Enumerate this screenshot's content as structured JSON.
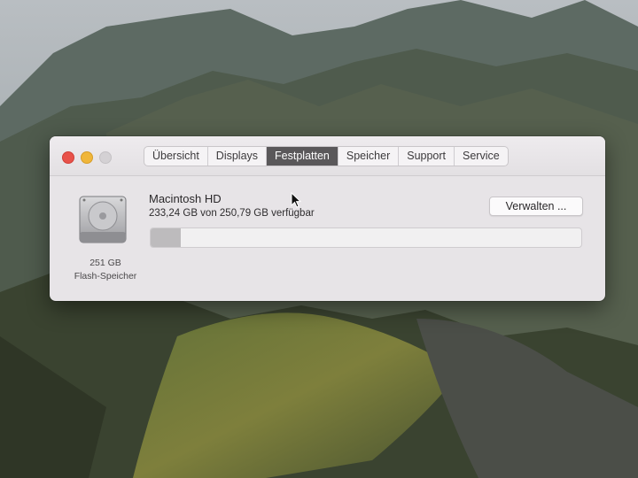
{
  "window": {
    "title_tabs": [
      {
        "label": "Übersicht",
        "active": false
      },
      {
        "label": "Displays",
        "active": false
      },
      {
        "label": "Festplatten",
        "active": true
      },
      {
        "label": "Speicher",
        "active": false
      },
      {
        "label": "Support",
        "active": false
      },
      {
        "label": "Service",
        "active": false
      }
    ]
  },
  "disk": {
    "icon": "hard-drive-icon",
    "size_label": "251 GB",
    "type_label": "Flash-Speicher"
  },
  "volume": {
    "name": "Macintosh HD",
    "info": "233,24 GB von 250,79 GB verfügbar",
    "used_fraction": 0.07,
    "manage_label": "Verwalten ..."
  },
  "colors": {
    "close": "#e8524a",
    "minimize": "#f0b63a",
    "active_tab": "#5a585a"
  }
}
